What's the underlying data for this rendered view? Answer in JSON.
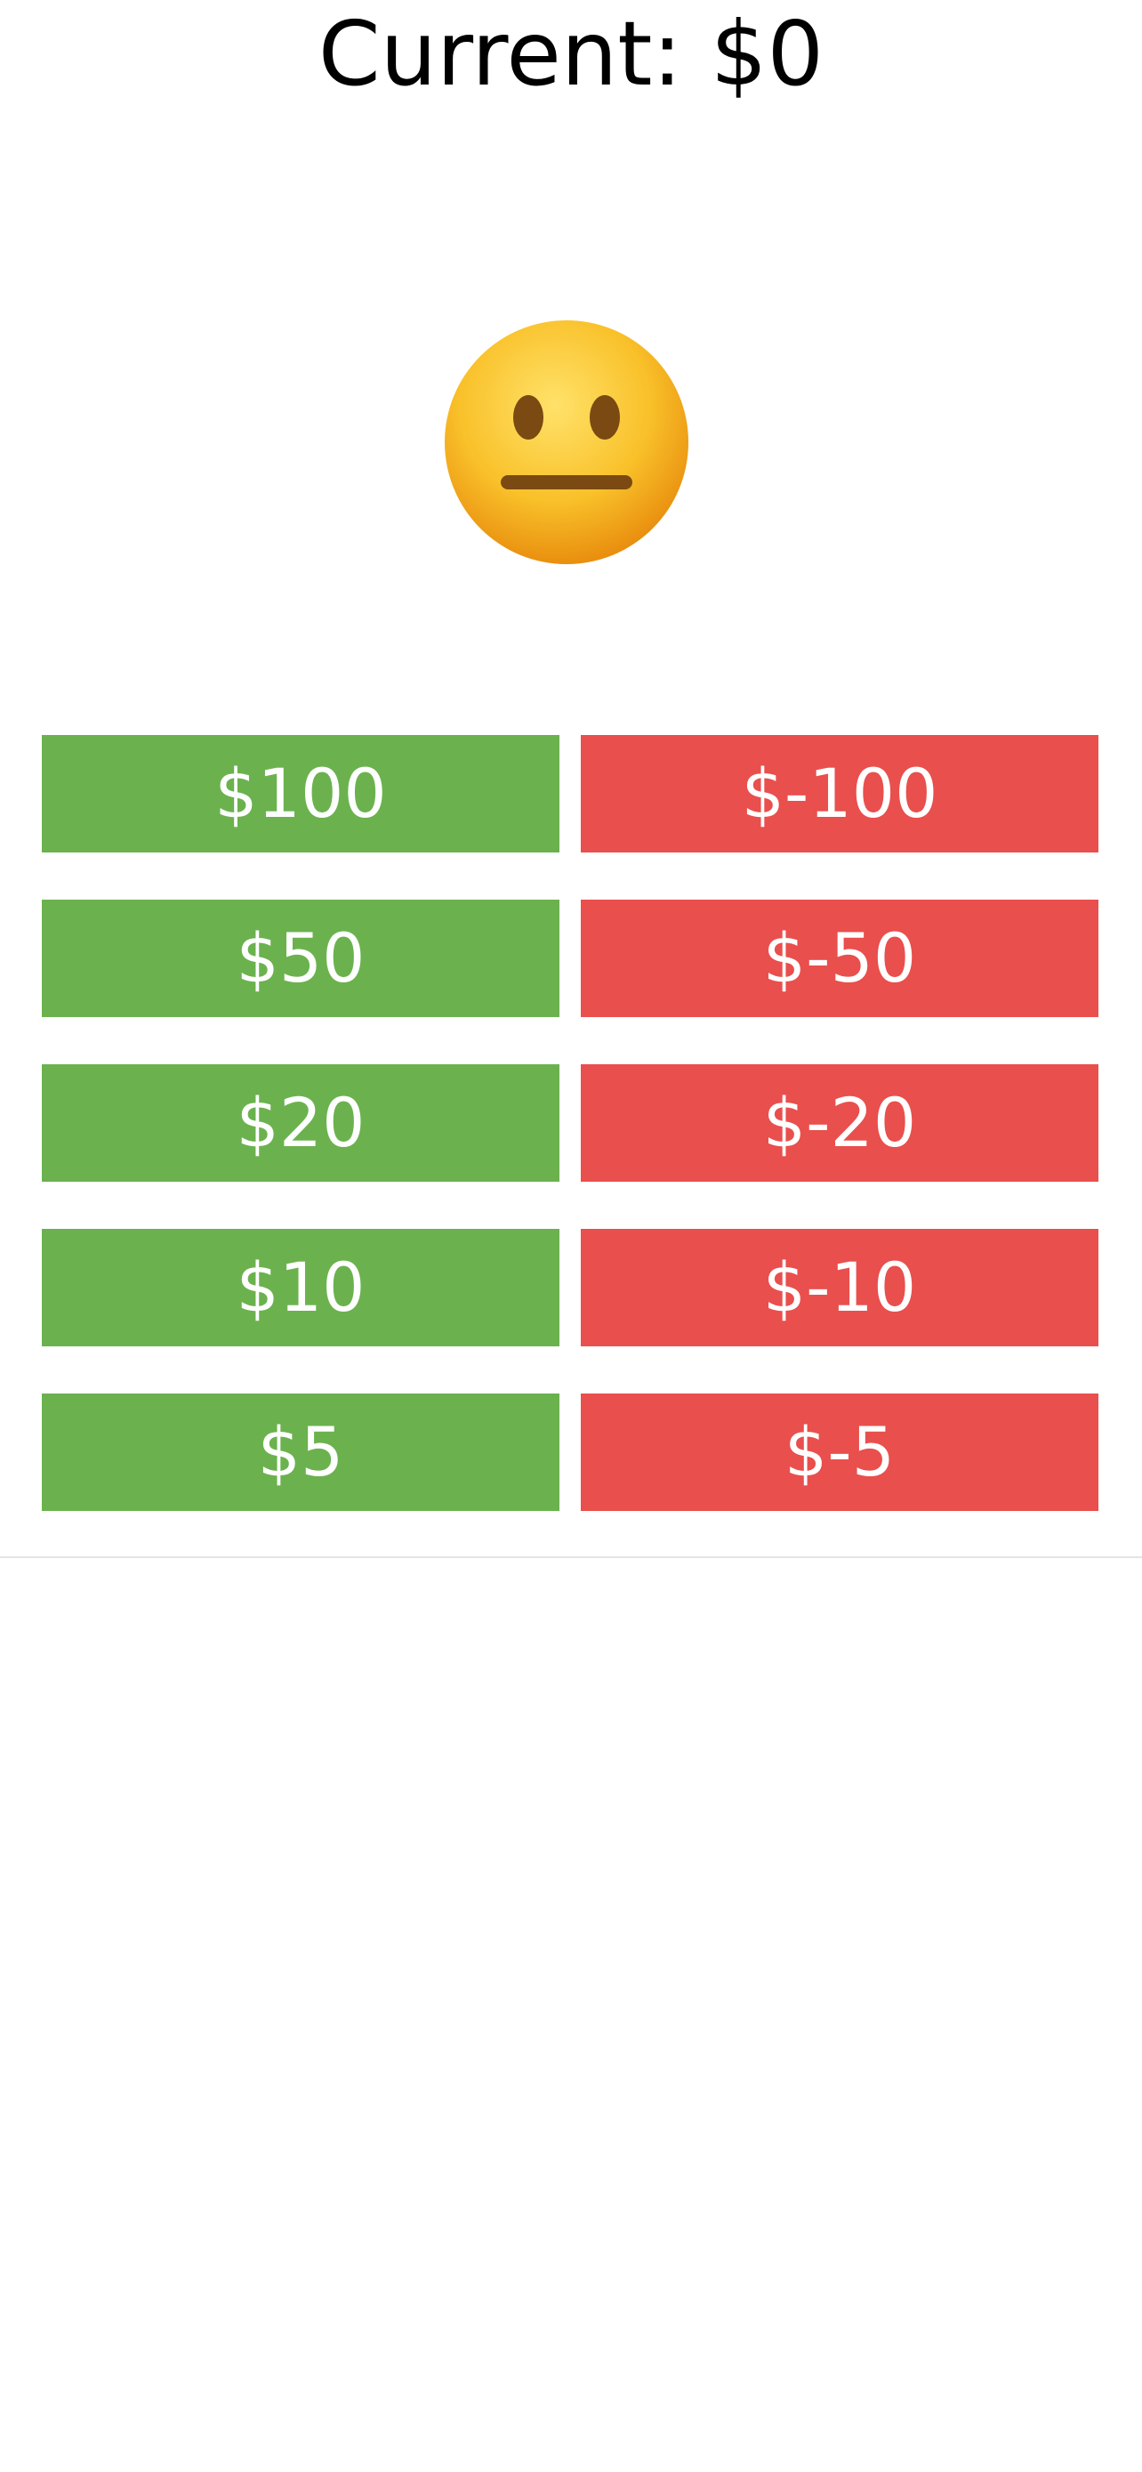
{
  "header": {
    "current_label": "Current: $0"
  },
  "mood": {
    "icon": "neutral-face-icon",
    "colors": {
      "face": "#f9b71c",
      "features": "#7a4a12"
    }
  },
  "buttons": {
    "add": [
      "$100",
      "$50",
      "$20",
      "$10",
      "$5"
    ],
    "subtract": [
      "$-100",
      "$-50",
      "$-20",
      "$-10",
      "$-5"
    ]
  },
  "colors": {
    "add": "#6bb24e",
    "subtract": "#e94f4d",
    "button_text": "#ffffff"
  }
}
